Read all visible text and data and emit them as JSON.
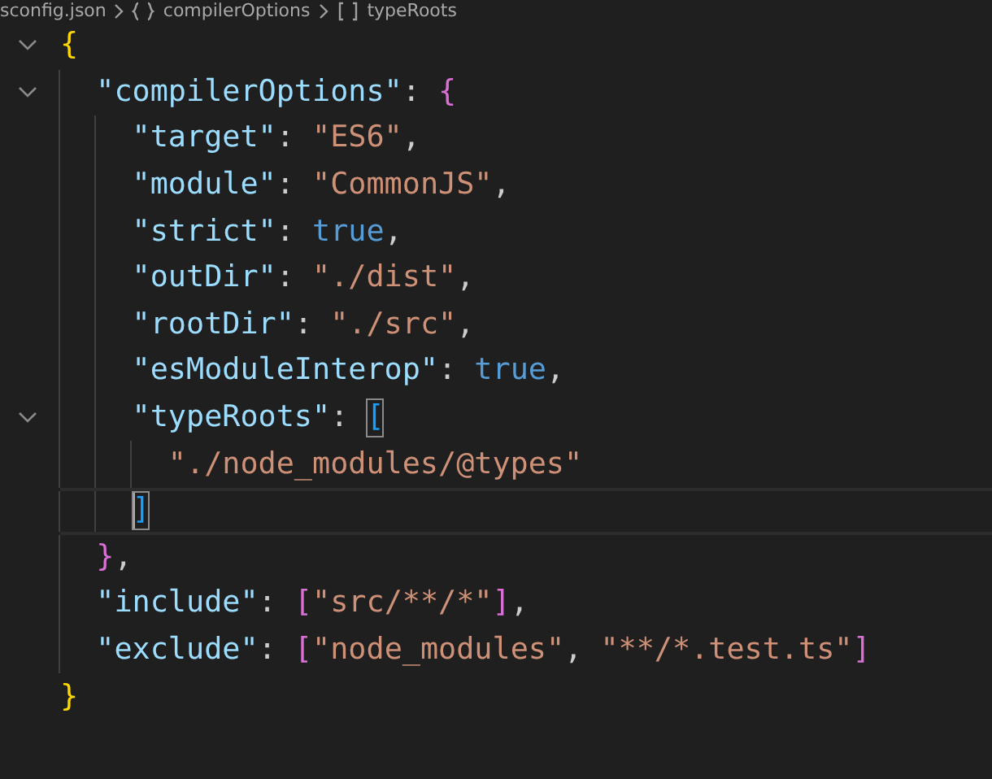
{
  "breadcrumb": [
    {
      "kind": "file",
      "label": "sconfig.json"
    },
    {
      "kind": "object",
      "label": "compilerOptions"
    },
    {
      "kind": "array",
      "label": "typeRoots"
    }
  ],
  "lines": [
    {
      "tokens": [
        {
          "kind": "bracket",
          "text": "{",
          "color": "#ffd700"
        }
      ],
      "expanded": true,
      "children": [
        {
          "tokens": [
            {
              "kind": "key",
              "text": "\"compilerOptions\""
            },
            {
              "kind": "punct",
              "text": ": "
            },
            {
              "kind": "bracket",
              "text": "{",
              "color": "#da70d6"
            }
          ],
          "expanded": true,
          "children": [
            {
              "tokens": [
                {
                  "kind": "key",
                  "text": "\"target\""
                },
                {
                  "kind": "punct",
                  "text": ": "
                },
                {
                  "kind": "string",
                  "text": "\"ES6\""
                },
                {
                  "kind": "punct",
                  "text": ","
                }
              ]
            },
            {
              "tokens": [
                {
                  "kind": "key",
                  "text": "\"module\""
                },
                {
                  "kind": "punct",
                  "text": ": "
                },
                {
                  "kind": "string",
                  "text": "\"CommonJS\""
                },
                {
                  "kind": "punct",
                  "text": ","
                }
              ]
            },
            {
              "tokens": [
                {
                  "kind": "key",
                  "text": "\"strict\""
                },
                {
                  "kind": "punct",
                  "text": ": "
                },
                {
                  "kind": "boolean",
                  "text": "true"
                },
                {
                  "kind": "punct",
                  "text": ","
                }
              ]
            },
            {
              "tokens": [
                {
                  "kind": "key",
                  "text": "\"outDir\""
                },
                {
                  "kind": "punct",
                  "text": ": "
                },
                {
                  "kind": "string",
                  "text": "\"./dist\""
                },
                {
                  "kind": "punct",
                  "text": ","
                }
              ]
            },
            {
              "tokens": [
                {
                  "kind": "key",
                  "text": "\"rootDir\""
                },
                {
                  "kind": "punct",
                  "text": ": "
                },
                {
                  "kind": "string",
                  "text": "\"./src\""
                },
                {
                  "kind": "punct",
                  "text": ","
                }
              ]
            },
            {
              "tokens": [
                {
                  "kind": "key",
                  "text": "\"esModuleInterop\""
                },
                {
                  "kind": "punct",
                  "text": ": "
                },
                {
                  "kind": "boolean",
                  "text": "true"
                },
                {
                  "kind": "punct",
                  "text": ","
                }
              ]
            },
            {
              "tokens": [
                {
                  "kind": "key",
                  "text": "\"typeRoots\""
                },
                {
                  "kind": "punct",
                  "text": ": "
                },
                {
                  "kind": "bracket",
                  "text": "[",
                  "color": "#179fff",
                  "matched": true
                }
              ],
              "expanded": true,
              "children": [
                {
                  "tokens": [
                    {
                      "kind": "string",
                      "text": "\"./node_modules/@types\""
                    }
                  ]
                }
              ],
              "closing": {
                "tokens": [
                  {
                    "kind": "bracket",
                    "text": "]",
                    "color": "#179fff",
                    "matched": true
                  }
                ],
                "current": true
              }
            }
          ],
          "closing": {
            "tokens": [
              {
                "kind": "bracket",
                "text": "}",
                "color": "#da70d6"
              },
              {
                "kind": "punct",
                "text": ","
              }
            ],
            "current": false
          }
        },
        {
          "tokens": [
            {
              "kind": "key",
              "text": "\"include\""
            },
            {
              "kind": "punct",
              "text": ": "
            },
            {
              "kind": "bracket",
              "text": "[",
              "color": "#da70d6"
            },
            {
              "kind": "string",
              "text": "\"src/**/*\""
            },
            {
              "kind": "bracket",
              "text": "]",
              "color": "#da70d6"
            },
            {
              "kind": "punct",
              "text": ","
            }
          ]
        },
        {
          "tokens": [
            {
              "kind": "key",
              "text": "\"exclude\""
            },
            {
              "kind": "punct",
              "text": ": "
            },
            {
              "kind": "bracket",
              "text": "[",
              "color": "#da70d6"
            },
            {
              "kind": "string",
              "text": "\"node_modules\""
            },
            {
              "kind": "punct",
              "text": ", "
            },
            {
              "kind": "string",
              "text": "\"**/*.test.ts\""
            },
            {
              "kind": "bracket",
              "text": "]",
              "color": "#da70d6"
            }
          ]
        }
      ],
      "closing": {
        "tokens": [
          {
            "kind": "bracket",
            "text": "}",
            "color": "#ffd700"
          }
        ],
        "current": false
      }
    }
  ]
}
